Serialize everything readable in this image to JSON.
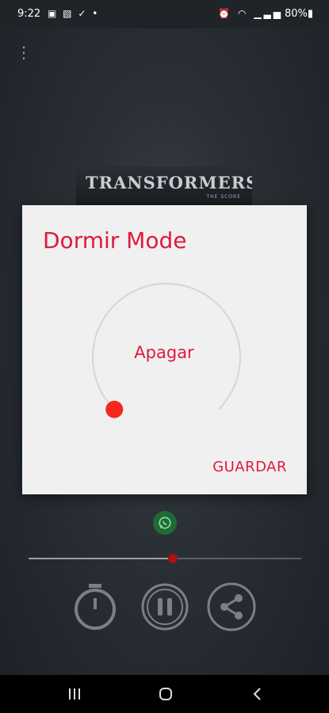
{
  "status_bar": {
    "time": "9:22",
    "battery": "80%",
    "icons": [
      "gallery-icon",
      "image-icon",
      "check-icon",
      "dot-icon",
      "alarm-icon",
      "wifi-icon",
      "signal-icon",
      "battery-icon"
    ]
  },
  "player": {
    "album_title": "TRANSFORMERS",
    "album_subtitle": "THE SCORE",
    "progress": 0.53,
    "accent_color": "#e0193e"
  },
  "dialog": {
    "title": "Dormir Mode",
    "dial_value_label": "Apagar",
    "dial_level": 0,
    "save_label": "GUARDAR"
  },
  "controls": [
    "timer-icon",
    "pause-icon",
    "share-icon"
  ],
  "nav_bar": [
    "recent-apps-icon",
    "home-icon",
    "back-icon"
  ]
}
